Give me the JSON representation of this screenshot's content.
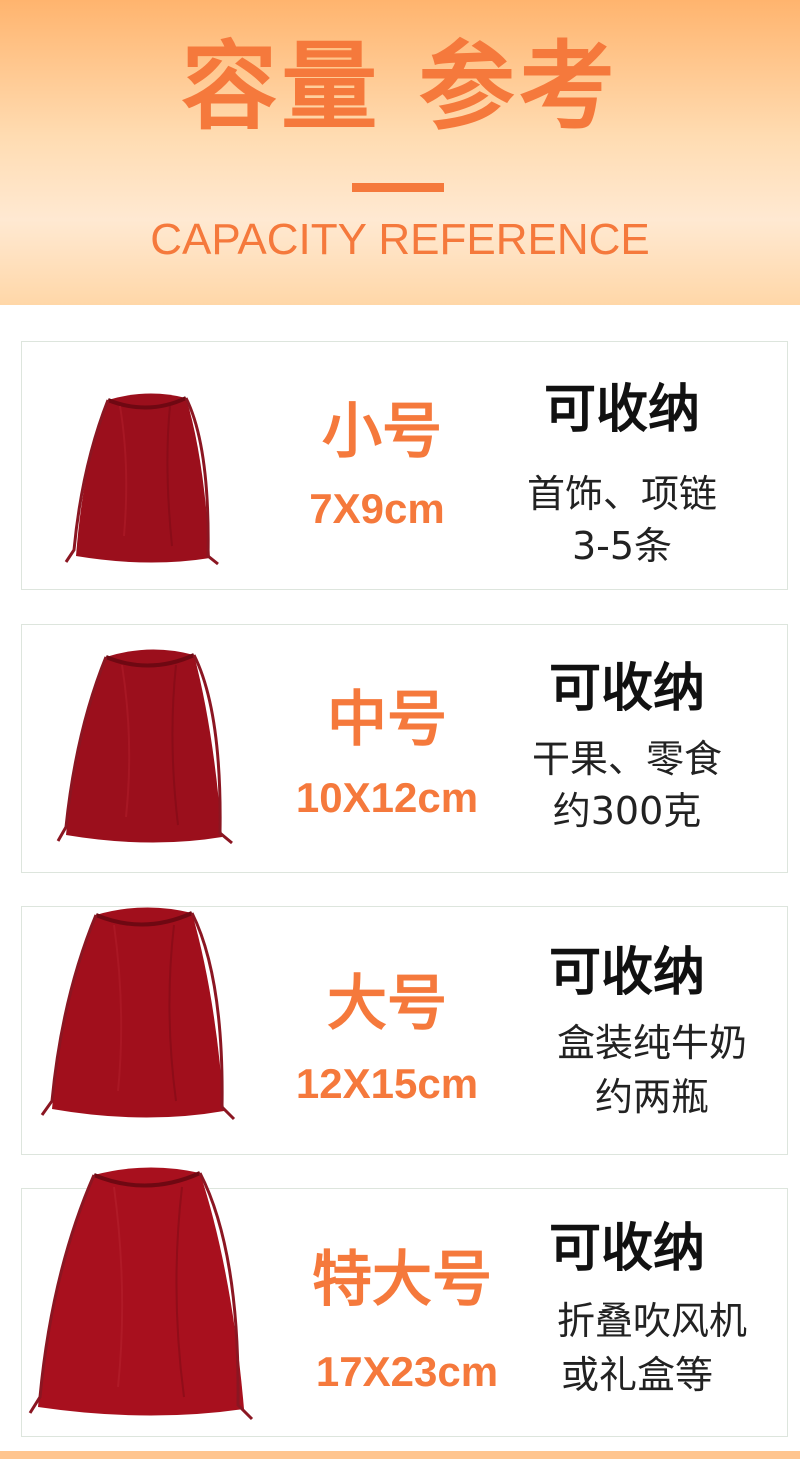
{
  "header": {
    "title": "容量 参考",
    "subtitle": "CAPACITY REFERENCE",
    "accent_color": "#f5793c"
  },
  "cards": [
    {
      "size_name": "小号",
      "dimensions": "7X9cm",
      "capacity_title": "可收纳",
      "capacity_line1": "首饰、项链",
      "capacity_line2": "3-5条",
      "icon": "red-velvet-drawstring-bag-icon"
    },
    {
      "size_name": "中号",
      "dimensions": "10X12cm",
      "capacity_title": "可收纳",
      "capacity_line1": "干果、零食",
      "capacity_line2": "约300克",
      "icon": "red-velvet-drawstring-bag-icon"
    },
    {
      "size_name": "大号",
      "dimensions": "12X15cm",
      "capacity_title": "可收纳",
      "capacity_line1": "盒装纯牛奶",
      "capacity_line2": "约两瓶",
      "icon": "red-velvet-drawstring-bag-icon"
    },
    {
      "size_name": "特大号",
      "dimensions": "17X23cm",
      "capacity_title": "可收纳",
      "capacity_line1": "折叠吹风机",
      "capacity_line2": "或礼盒等",
      "icon": "red-velvet-drawstring-bag-icon"
    }
  ]
}
